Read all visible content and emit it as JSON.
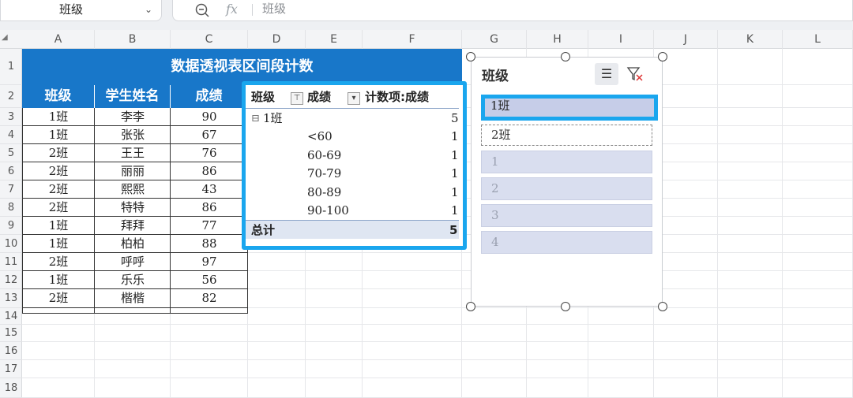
{
  "namebox": {
    "value": "班级",
    "chevron": "chevron-down-icon"
  },
  "formula": {
    "zoom_icon": "zoom-icon",
    "fx_label": "fx",
    "value": "班级"
  },
  "columns": [
    "A",
    "B",
    "C",
    "D",
    "E",
    "F",
    "G",
    "H",
    "I",
    "J",
    "K",
    "L"
  ],
  "rows": [
    "1",
    "2",
    "3",
    "4",
    "5",
    "6",
    "7",
    "8",
    "9",
    "10",
    "11",
    "12",
    "13",
    "14",
    "15",
    "16",
    "17",
    "18"
  ],
  "table": {
    "title": "数据透视表区间段计数",
    "headers": [
      "班级",
      "学生姓名",
      "成绩"
    ],
    "data": [
      [
        "1班",
        "李李",
        "90"
      ],
      [
        "1班",
        "张张",
        "67"
      ],
      [
        "2班",
        "王王",
        "76"
      ],
      [
        "2班",
        "丽丽",
        "86"
      ],
      [
        "2班",
        "熙熙",
        "43"
      ],
      [
        "2班",
        "特特",
        "86"
      ],
      [
        "1班",
        "拜拜",
        "77"
      ],
      [
        "1班",
        "柏柏",
        "88"
      ],
      [
        "2班",
        "呼呼",
        "97"
      ],
      [
        "1班",
        "乐乐",
        "56"
      ],
      [
        "2班",
        "楷楷",
        "82"
      ]
    ]
  },
  "pivot": {
    "header_class": "班级",
    "header_score": "成绩",
    "header_count": "计数项:成绩",
    "group_toggle": "⊟",
    "group_label": "1班",
    "group_count": "5",
    "rows": [
      {
        "label": "<60",
        "count": "1"
      },
      {
        "label": "60-69",
        "count": "1"
      },
      {
        "label": "70-79",
        "count": "1"
      },
      {
        "label": "80-89",
        "count": "1"
      },
      {
        "label": "90-100",
        "count": "1"
      }
    ],
    "total_label": "总计",
    "total_count": "5"
  },
  "slicer": {
    "title": "班级",
    "items": [
      {
        "label": "1班",
        "state": "selected"
      },
      {
        "label": "2班",
        "state": "available"
      },
      {
        "label": "1",
        "state": "nodata"
      },
      {
        "label": "2",
        "state": "nodata"
      },
      {
        "label": "3",
        "state": "nodata"
      },
      {
        "label": "4",
        "state": "nodata"
      }
    ]
  },
  "colors": {
    "header_blue": "#1877c9",
    "highlight": "#1aa6ee",
    "slicer_item": "#d9deef"
  }
}
